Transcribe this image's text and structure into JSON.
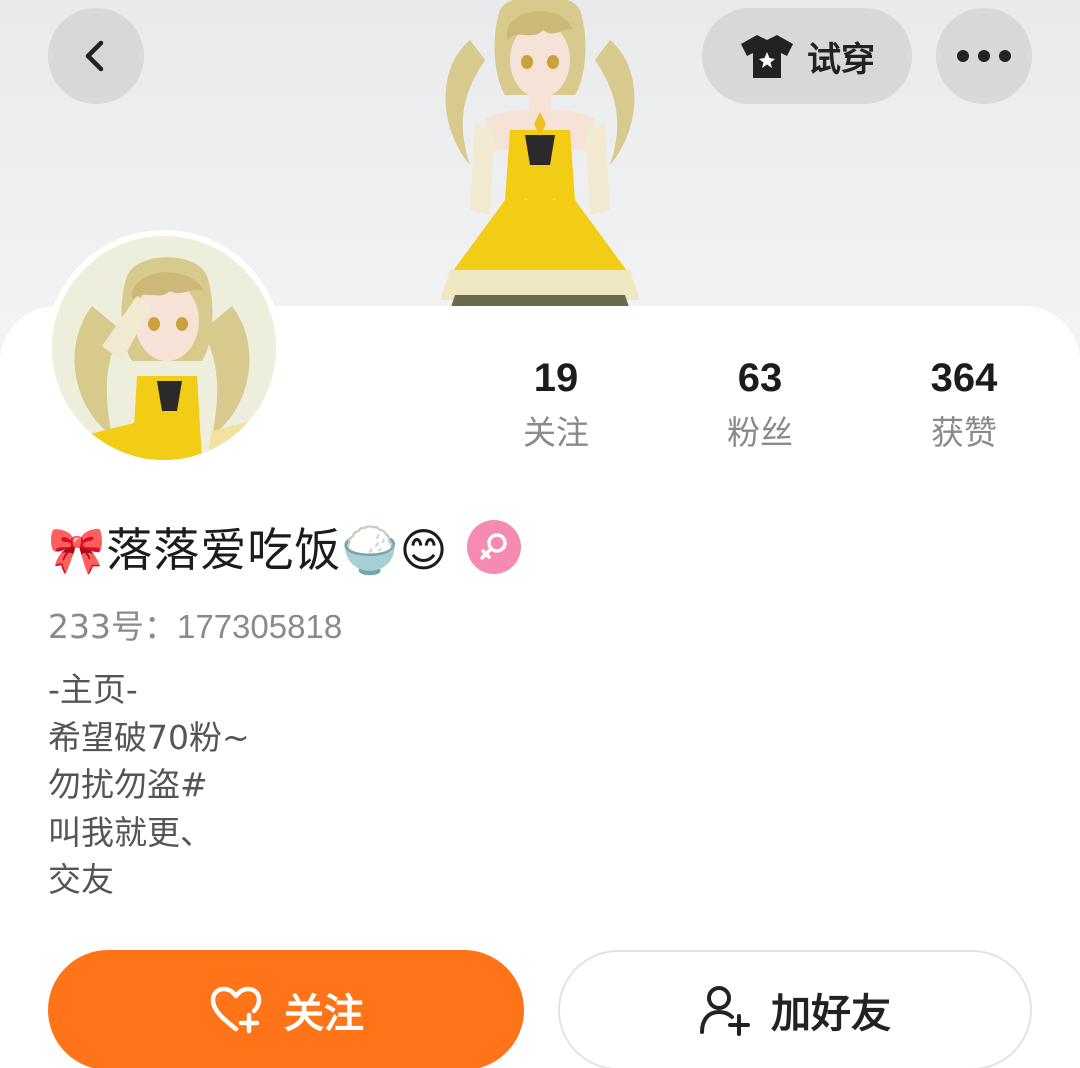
{
  "header": {
    "back_icon": "chevron-left-icon",
    "try_on_label": "试穿",
    "try_on_icon": "shirt-icon",
    "more_icon": "more-dots-icon"
  },
  "profile": {
    "name": "🎀落落爱吃饭🍚😊",
    "gender_icon": "female-icon",
    "uid_prefix": "233号：",
    "uid": "177305818",
    "bio": [
      "-主页-",
      "希望破70粉~",
      "勿扰勿盗#",
      "叫我就更、",
      "交友"
    ]
  },
  "stats": [
    {
      "value": "19",
      "label": "关注"
    },
    {
      "value": "63",
      "label": "粉丝"
    },
    {
      "value": "364",
      "label": "获赞"
    }
  ],
  "actions": {
    "follow_label": "关注",
    "add_friend_label": "加好友"
  },
  "colors": {
    "accent": "#ff7418",
    "gender_badge": "#f58bb0",
    "dress": "#f3cc16",
    "hair": "#d8c98c"
  }
}
